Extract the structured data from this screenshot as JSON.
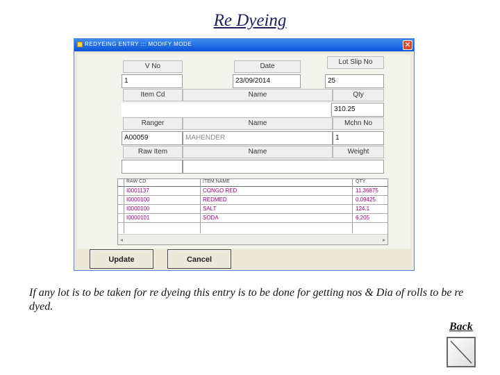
{
  "slide": {
    "title": "Re Dyeing",
    "note": "If any lot is to be taken for re dyeing this entry is to be done for getting nos & Dia of rolls to be re dyed.",
    "back": "Back"
  },
  "window": {
    "title": "REDYEING ENTRY  :::  MODIFY MODE",
    "close": "✕"
  },
  "form": {
    "labels": {
      "vno": "V No",
      "date": "Date",
      "lot_slip_no": "Lot Slip No",
      "item_cd": "Item Cd",
      "item_name": "Name",
      "qty": "Qty",
      "ranger": "Ranger",
      "ranger_name": "Name",
      "mchn_no": "Mchn No",
      "raw_item": "Raw Item",
      "raw_name": "Name",
      "weight": "Weight"
    },
    "values": {
      "vno": "1",
      "date": "23/09/2014",
      "lot_slip_no": "25",
      "qty": "310.25",
      "ranger_code": "A00059",
      "ranger_name": "MAHENDER",
      "mchn_no": "1"
    }
  },
  "grid": {
    "headers": [
      "RAW CD",
      "ITEM NAME",
      "QTY"
    ],
    "rows": [
      [
        "I0001137",
        "CONGO RED",
        "11.36875"
      ],
      [
        "I0000100",
        "REDMED",
        "0.09425"
      ],
      [
        "I0000100",
        "SALT",
        "124.1"
      ],
      [
        "I0000101",
        "SODA",
        "6.205"
      ]
    ]
  },
  "buttons": {
    "update": "Update",
    "cancel": "Cancel"
  },
  "colors": {
    "titlebar": "#0a53d8",
    "grid_text": "#a0007a",
    "window_bg": "#ece9d8"
  },
  "icons": {
    "scroll_left": "◂",
    "scroll_right": "▸"
  }
}
